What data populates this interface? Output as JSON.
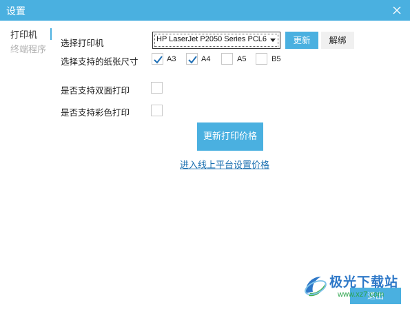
{
  "window": {
    "title": "设置",
    "close_icon": "close-icon"
  },
  "sidebar": {
    "items": [
      {
        "label": "打印机",
        "active": true
      },
      {
        "label": "终端程序",
        "active": false
      }
    ]
  },
  "printer": {
    "select_label": "选择打印机",
    "selected_printer": "HP LaserJet P2050 Series PCL6",
    "refresh_label": "更新",
    "unbind_label": "解绑"
  },
  "paper": {
    "label": "选择支持的纸张尺寸",
    "sizes": [
      {
        "name": "A3",
        "checked": true
      },
      {
        "name": "A4",
        "checked": true
      },
      {
        "name": "A5",
        "checked": false
      },
      {
        "name": "B5",
        "checked": false
      }
    ]
  },
  "duplex": {
    "label": "是否支持双面打印",
    "checked": false
  },
  "color": {
    "label": "是否支持彩色打印",
    "checked": false
  },
  "actions": {
    "update_price_label": "更新打印价格",
    "online_link_label": "进入线上平台设置价格",
    "exit_label": "退出"
  },
  "watermark": {
    "brand": "极光下载站",
    "url": "www.xz7.com"
  },
  "colors": {
    "accent": "#4ab0e0",
    "link": "#1a6fb0",
    "check": "#1f6fb5"
  }
}
